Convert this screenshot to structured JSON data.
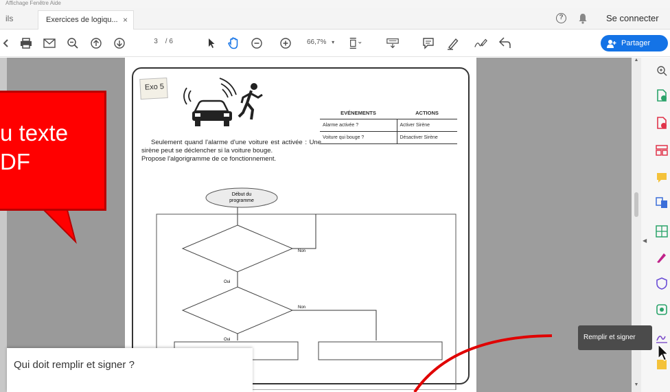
{
  "menu_strip": "Affichage   Fenêtre   Aide",
  "tabs": {
    "tools_label": "ils",
    "document_title": "Exercices de logiqu...",
    "close_glyph": "×"
  },
  "header": {
    "help_glyph": "?",
    "signin_label": "Se connecter"
  },
  "toolbar": {
    "page_current": "3",
    "page_total": "/ 6",
    "zoom_value": "66,7%",
    "share_label": "Partager"
  },
  "document": {
    "exo_label": "Exo 5",
    "problem_text_1": "Seulement quand l'alarme d'une voiture est activée : Une sirène peut se déclencher si la voiture bouge.",
    "problem_text_2": "Propose l'algorigramme de ce fonctionnement.",
    "table": {
      "headers": [
        "EVÉNEMENTS",
        "ACTIONS"
      ],
      "rows": [
        [
          "Alarme activée ?",
          "Activer Sirène"
        ],
        [
          "Voiture qui bouge ?",
          "Désactiver Sirène"
        ]
      ]
    },
    "flowchart": {
      "start_label_1": "Début du",
      "start_label_2": "programme",
      "no_label_1": "Non",
      "yes_label_1": "Oui",
      "no_label_2": "Non",
      "yes_label_2": "Oui"
    }
  },
  "tooltip": "Remplir et signer",
  "dialog": {
    "title": "Qui doit remplir et signer ?"
  },
  "callout": {
    "line1": "u texte",
    "line2": "DF"
  },
  "colors": {
    "accent": "#1473e6",
    "callout": "#ff0000",
    "annotation_line": "#e00000"
  },
  "right_panel_icons": [
    "zoom-search-icon",
    "create-pdf-icon",
    "export-pdf-icon",
    "organize-pages-icon",
    "comment-icon",
    "combine-files-icon",
    "edit-pdf-icon",
    "sign-icon",
    "protect-icon",
    "scan-ocr-icon",
    "fill-sign-icon",
    "more-tools-icon"
  ]
}
